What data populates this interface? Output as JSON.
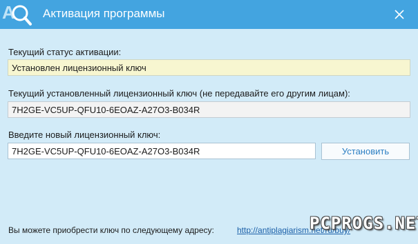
{
  "window": {
    "title": "Активация программы",
    "app_icon": "magnifier-a-icon",
    "close_icon": "close-icon"
  },
  "status": {
    "label": "Текущий статус активации:",
    "value": "Установлен лицензионный ключ"
  },
  "current_key": {
    "label": "Текущий установленный лицензионный ключ (не передавайте его другим лицам):",
    "value": "7H2GE-VC5UP-QFU10-6EOAZ-A27O3-B034R"
  },
  "new_key": {
    "label": "Введите новый лицензионный ключ:",
    "value": "7H2GE-VC5UP-QFU10-6EOAZ-A27O3-B034R",
    "button_label": "Установить"
  },
  "footer": {
    "text": "Вы можете приобрести ключ по следующему адресу:",
    "link": "http://antiplagiarism.net/ru/buy/"
  },
  "watermark": "PCPROGS.NET",
  "colors": {
    "titlebar": "#43a4e0",
    "background": "#d2ebf8",
    "status_field": "#f7f6d0",
    "button_text": "#2c7fc3",
    "link": "#1a5fa8"
  }
}
